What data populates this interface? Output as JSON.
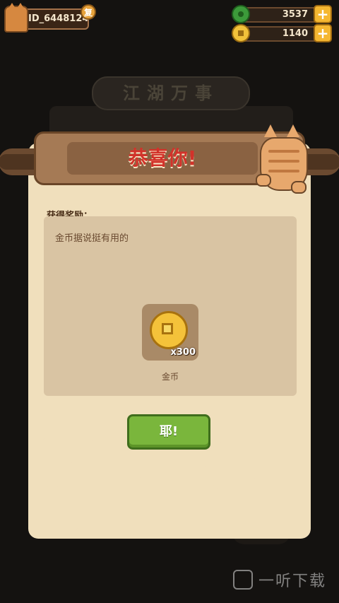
{
  "background": {
    "banner_text": "江湖万事"
  },
  "top_bar": {
    "player_id": "ID_6448124",
    "copy_label": "复",
    "resources": [
      {
        "icon": "jade-icon",
        "value": "3537"
      },
      {
        "icon": "gold-coin-icon",
        "value": "1140"
      }
    ],
    "plus_label": "+"
  },
  "dialog": {
    "title": "恭喜你!",
    "reward_label": "获得奖励：",
    "reward_description": "金币据说挺有用的",
    "item": {
      "icon": "gold-coin-icon",
      "count": "x300",
      "name": "金币"
    },
    "confirm_label": "耶!"
  },
  "watermark": {
    "text": "一听下载"
  },
  "colors": {
    "title_red": "#d2322a",
    "button_green": "#7ab63c",
    "paper": "#f0dfbc"
  }
}
